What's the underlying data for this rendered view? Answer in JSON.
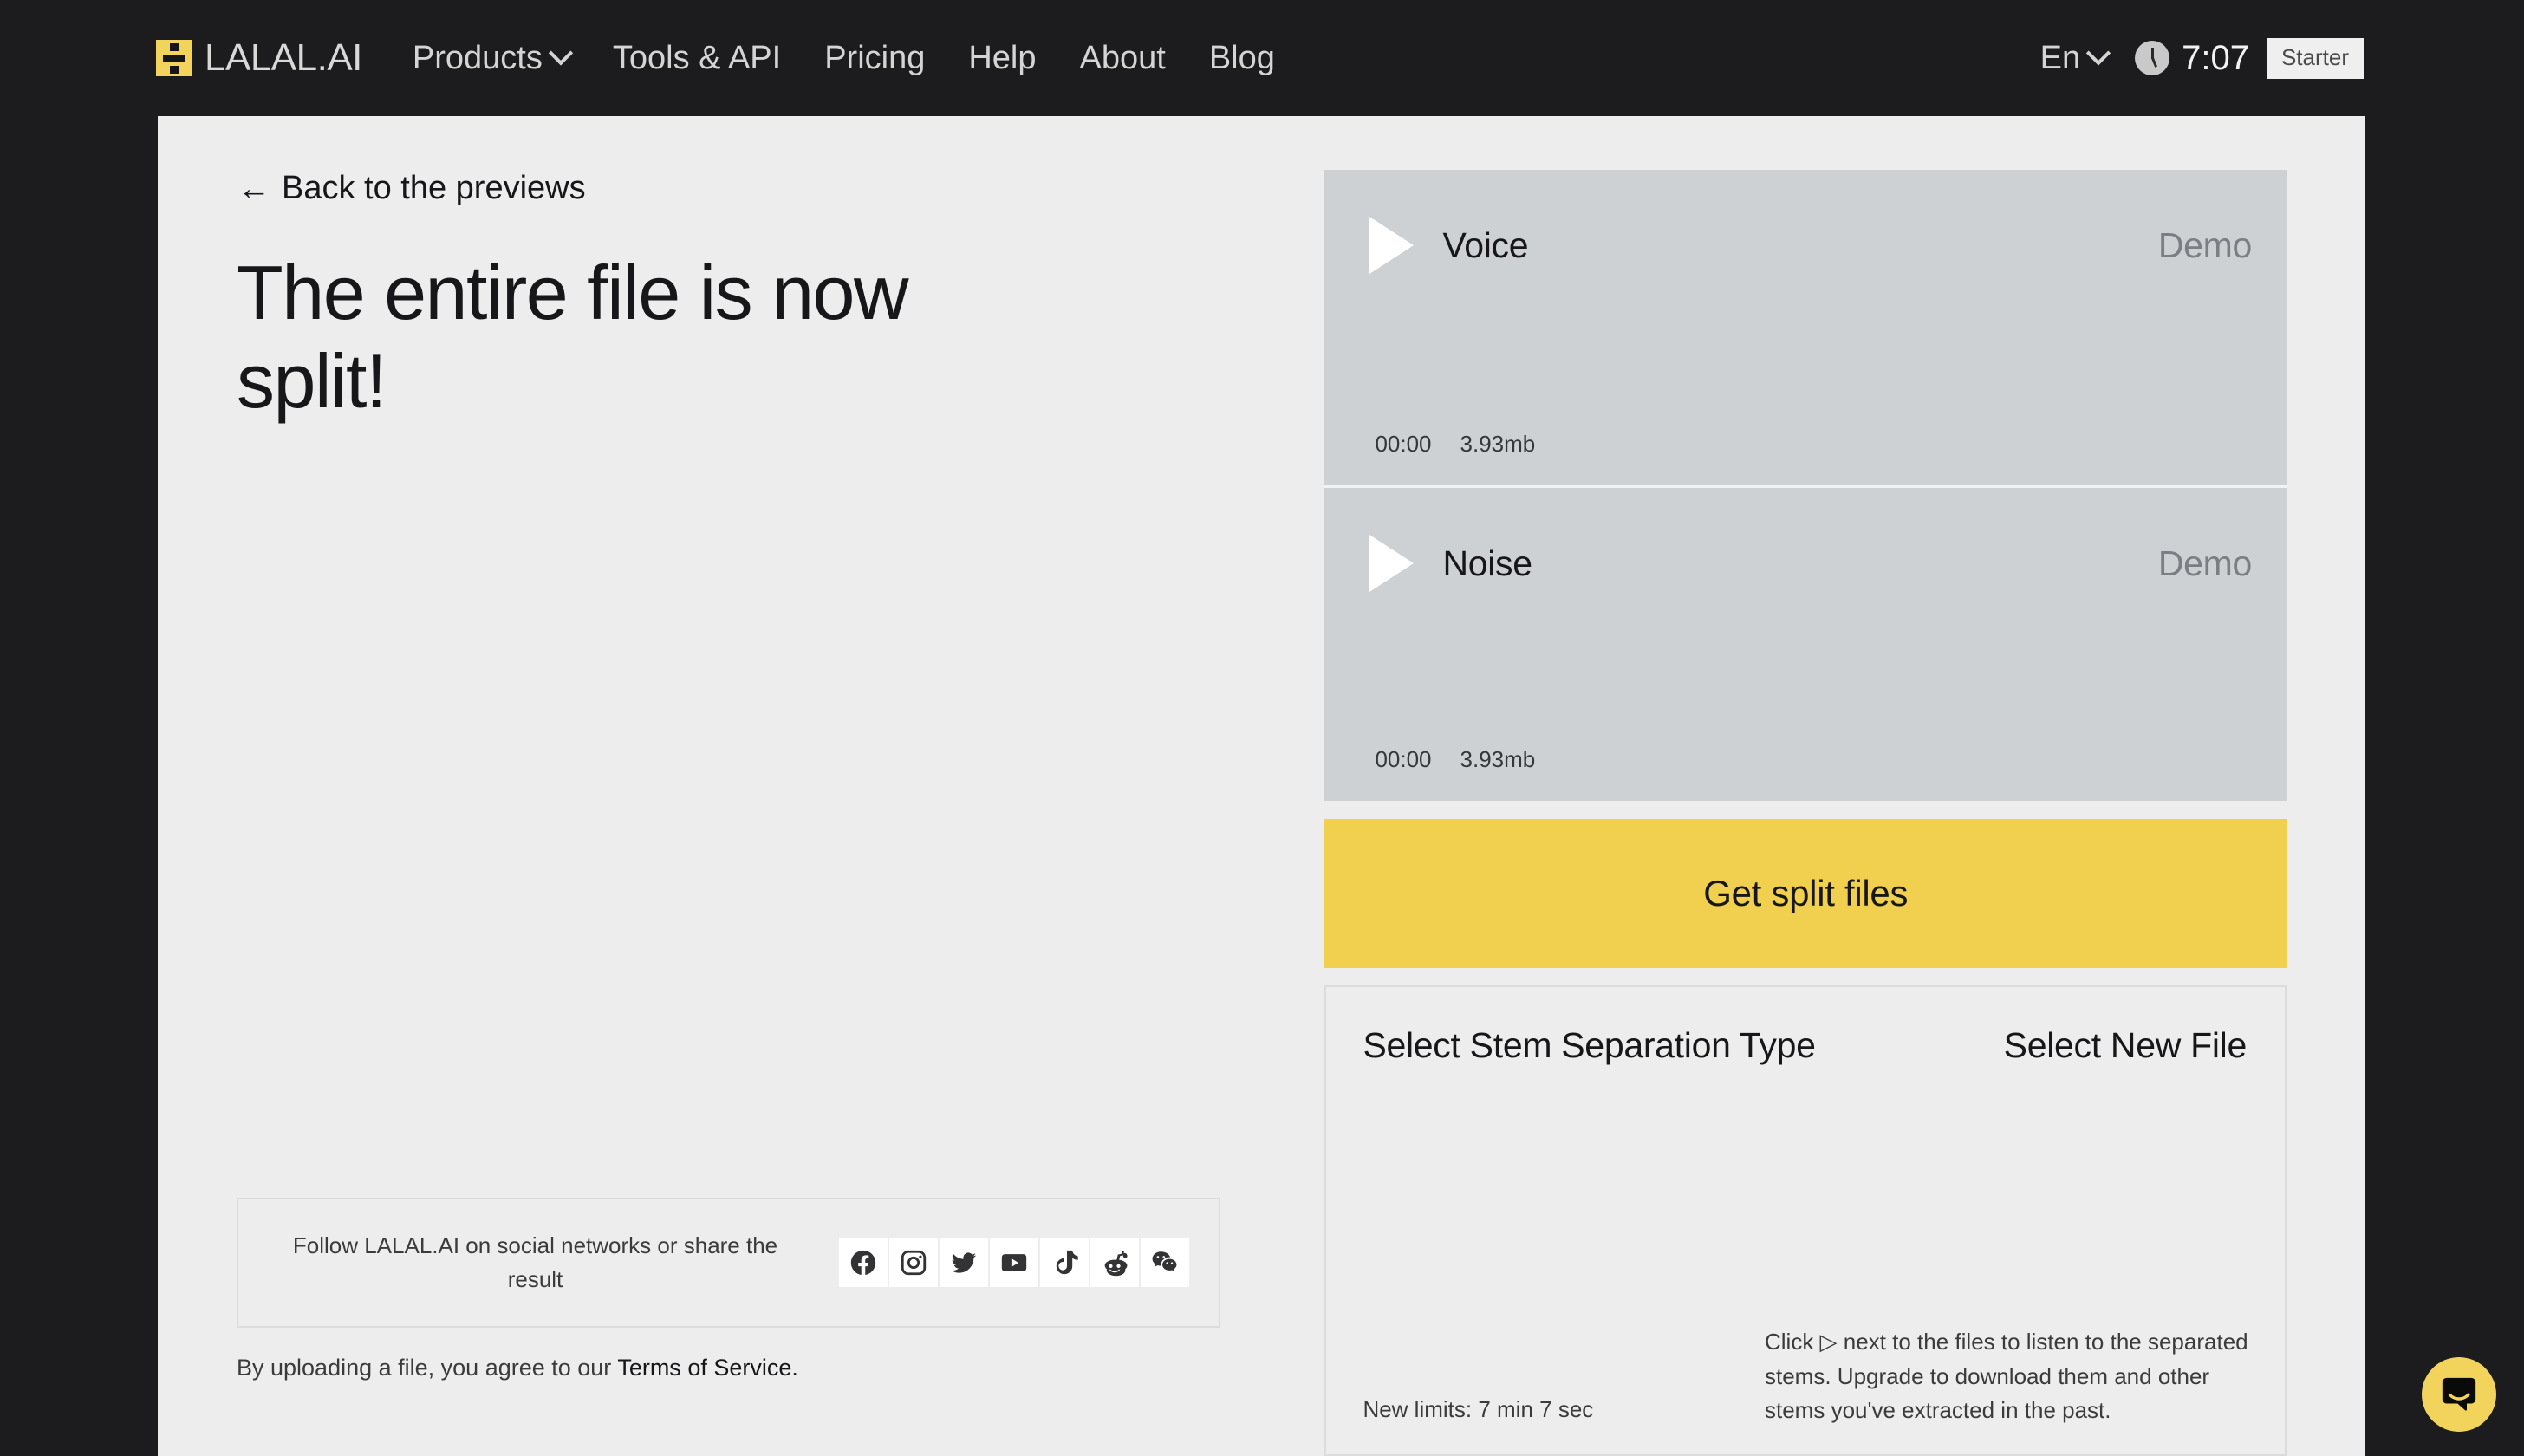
{
  "header": {
    "logo_icon": "division-logo-icon",
    "brand": "LALAL.AI",
    "nav": [
      {
        "label": "Products",
        "has_caret": true
      },
      {
        "label": "Tools & API",
        "has_caret": false
      },
      {
        "label": "Pricing",
        "has_caret": false
      },
      {
        "label": "Help",
        "has_caret": false
      },
      {
        "label": "About",
        "has_caret": false
      },
      {
        "label": "Blog",
        "has_caret": false
      }
    ],
    "language": "En",
    "clock_icon": "clock-icon",
    "time_remaining": "7:07",
    "plan_badge": "Starter"
  },
  "main": {
    "back_link": "Back to the previews",
    "back_arrow": "←",
    "headline": "The entire file is now split!"
  },
  "players": [
    {
      "name": "Voice",
      "tag": "Demo",
      "time": "00:00",
      "size": "3.93mb",
      "play_icon": "play-icon"
    },
    {
      "name": "Noise",
      "tag": "Demo",
      "time": "00:00",
      "size": "3.93mb",
      "play_icon": "play-icon"
    }
  ],
  "actions": {
    "get_split_files": "Get split files",
    "select_stem_type": "Select Stem Separation Type",
    "select_new_file": "Select New File",
    "new_limits": "New limits: 7 min 7 sec",
    "hint": "Click ▷ next to the files to listen to the separated stems. Upgrade to download them and other stems you've extracted in the past."
  },
  "social": {
    "caption": "Follow LALAL.AI on social networks or share the result",
    "networks": [
      "facebook-icon",
      "instagram-icon",
      "twitter-icon",
      "youtube-icon",
      "tiktok-icon",
      "reddit-icon",
      "wechat-icon"
    ]
  },
  "footer": {
    "terms_prefix": "By uploading a file, you agree to our ",
    "terms_link": "Terms of Service."
  },
  "chat": {
    "icon": "chat-bubble-icon"
  },
  "colors": {
    "page_background": "#1C1C1E",
    "panel_background": "#EDEDED",
    "accent_yellow": "#F0D04E",
    "player_background": "#CDD1D3",
    "text_primary": "#17171A",
    "text_muted": "#7A7F84"
  }
}
